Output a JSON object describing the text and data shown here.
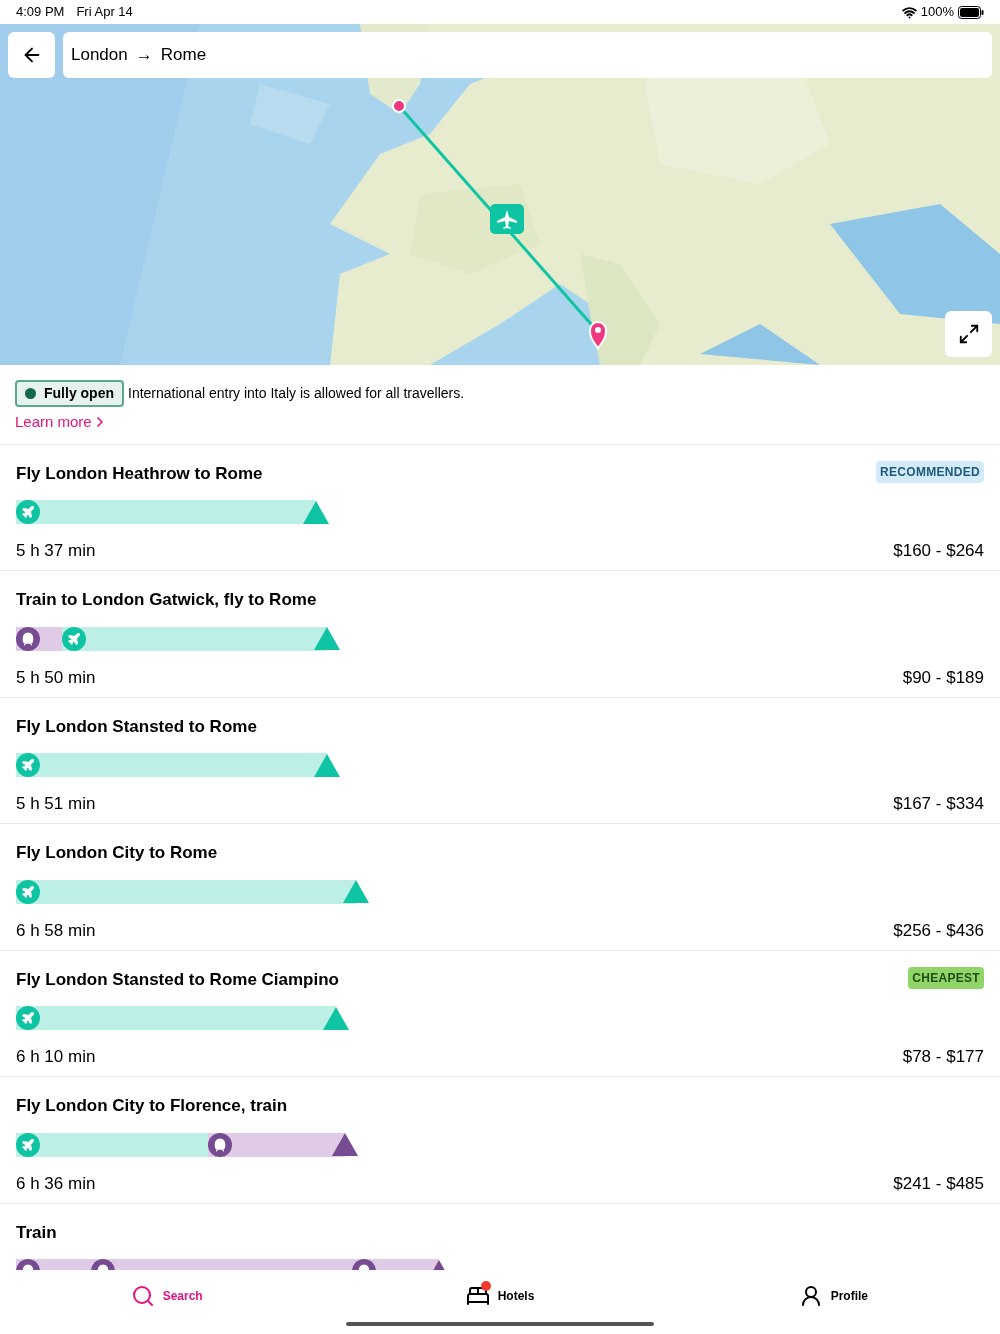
{
  "status_bar": {
    "time": "4:09 PM",
    "date": "Fri Apr 14",
    "battery": "100%"
  },
  "search": {
    "origin": "London",
    "arrow": "→",
    "destination": "Rome"
  },
  "notice": {
    "status": "Fully open",
    "text": "International entry into Italy is allowed for all travellers.",
    "link": "Learn more"
  },
  "routes": [
    {
      "title": "Fly London Heathrow to Rome",
      "badge": {
        "kind": "recommended",
        "label": "RECOMMENDED"
      },
      "duration": "5 h 37 min",
      "price": "$160 - $264",
      "segments": [
        {
          "kind": "flight"
        }
      ]
    },
    {
      "title": "Train to London Gatwick, fly to Rome",
      "duration": "5 h 50 min",
      "price": "$90 - $189",
      "segments": [
        {
          "kind": "train"
        },
        {
          "kind": "flight"
        }
      ]
    },
    {
      "title": "Fly London Stansted to Rome",
      "duration": "5 h 51 min",
      "price": "$167 - $334",
      "segments": [
        {
          "kind": "flight"
        }
      ]
    },
    {
      "title": "Fly London City to Rome",
      "duration": "6 h 58 min",
      "price": "$256 - $436",
      "segments": [
        {
          "kind": "flight"
        }
      ]
    },
    {
      "title": "Fly London Stansted to Rome Ciampino",
      "badge": {
        "kind": "cheapest",
        "label": "CHEAPEST"
      },
      "duration": "6 h 10 min",
      "price": "$78 - $177",
      "segments": [
        {
          "kind": "flight"
        }
      ]
    },
    {
      "title": "Fly London City to Florence, train",
      "duration": "6 h 36 min",
      "price": "$241 - $485",
      "segments": [
        {
          "kind": "flight"
        },
        {
          "kind": "train"
        }
      ]
    },
    {
      "title": "Train",
      "segments": [
        {
          "kind": "train"
        },
        {
          "kind": "train"
        },
        {
          "kind": "train"
        }
      ]
    }
  ],
  "tabs": [
    {
      "kind": "search",
      "label": "Search",
      "selected": true,
      "notification": false
    },
    {
      "kind": "hotels",
      "label": "Hotels",
      "selected": false,
      "notification": true
    },
    {
      "kind": "profile",
      "label": "Profile",
      "selected": false,
      "notification": false
    }
  ]
}
